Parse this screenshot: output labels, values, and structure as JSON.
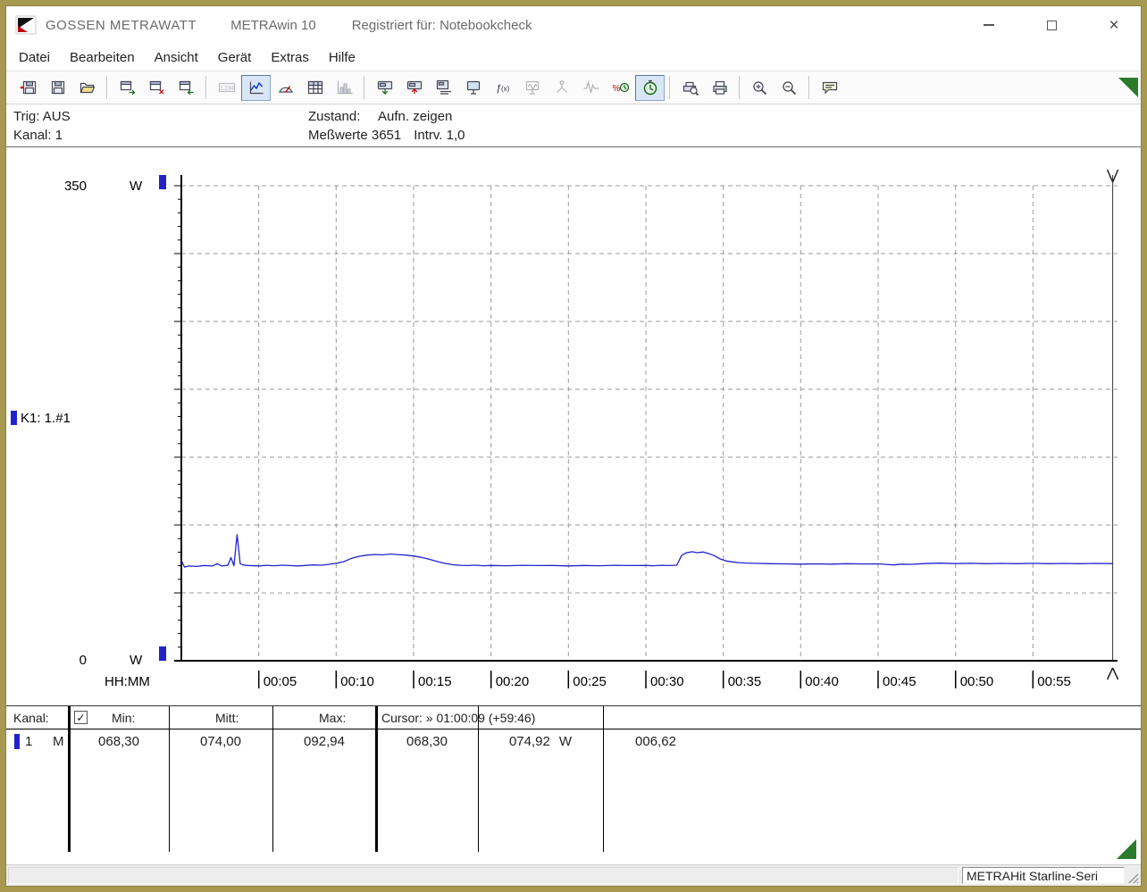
{
  "titlebar": {
    "brand": "GOSSEN METRAWATT",
    "app_title": "METRAwin 10",
    "registered": "Registriert für: Notebookcheck",
    "close_glyph": "×"
  },
  "menu": {
    "items": [
      {
        "name": "menu-item-datei",
        "label": "Datei"
      },
      {
        "name": "menu-item-bearbeiten",
        "label": "Bearbeiten"
      },
      {
        "name": "menu-item-ansicht",
        "label": "Ansicht"
      },
      {
        "name": "menu-item-geraet",
        "label": "Gerät"
      },
      {
        "name": "menu-item-extras",
        "label": "Extras"
      },
      {
        "name": "menu-item-hilfe",
        "label": "Hilfe"
      }
    ]
  },
  "toolbar": {
    "groups": [
      [
        {
          "name": "new-recording-button",
          "glyph": "disk-in"
        },
        {
          "name": "save-button",
          "glyph": "disk"
        },
        {
          "name": "open-button",
          "glyph": "folder"
        }
      ],
      [
        {
          "name": "export-window-button",
          "glyph": "win-out"
        },
        {
          "name": "close-window-button",
          "glyph": "win-red"
        },
        {
          "name": "import-window-button",
          "glyph": "win-in"
        }
      ],
      [
        {
          "name": "view-numeric-button",
          "glyph": "numeric",
          "disabled": true
        },
        {
          "name": "view-chart-button",
          "glyph": "chart",
          "active": true
        },
        {
          "name": "view-meter-button",
          "glyph": "meter"
        },
        {
          "name": "view-table-button",
          "glyph": "table"
        },
        {
          "name": "view-histogram-button",
          "glyph": "histogram",
          "disabled": true
        }
      ],
      [
        {
          "name": "device-read-button",
          "glyph": "dev-read"
        },
        {
          "name": "device-send-button",
          "glyph": "dev-send"
        },
        {
          "name": "device-list-button",
          "glyph": "dev-list"
        },
        {
          "name": "device-monitor-button",
          "glyph": "monitor"
        },
        {
          "name": "device-function-button",
          "glyph": "fx"
        },
        {
          "name": "device-scope-button",
          "glyph": "monitor-wave",
          "disabled": true
        },
        {
          "name": "device-branch-button",
          "glyph": "branch",
          "disabled": true
        },
        {
          "name": "device-waveform-button",
          "glyph": "wave",
          "disabled": true
        },
        {
          "name": "device-percent-timer-button",
          "glyph": "percent-clock"
        },
        {
          "name": "device-timer-button",
          "glyph": "timer",
          "active": true
        }
      ],
      [
        {
          "name": "print-preview-button",
          "glyph": "print-zoom"
        },
        {
          "name": "print-button",
          "glyph": "printer"
        }
      ],
      [
        {
          "name": "zoom-in-button",
          "glyph": "zoom-in"
        },
        {
          "name": "zoom-out-button",
          "glyph": "zoom-out"
        }
      ],
      [
        {
          "name": "annotation-button",
          "glyph": "note"
        }
      ]
    ]
  },
  "status_panel": {
    "trig": "Trig: AUS",
    "kanal": "Kanal: 1",
    "zustand_label": "Zustand:",
    "zustand_value": "Aufn. zeigen",
    "messwerte": "Meßwerte 3651",
    "intrv": "Intrv. 1,0"
  },
  "chart_data": {
    "type": "line",
    "title": "",
    "ylabel_top": "350",
    "ylabel_bottom": "0",
    "y_unit": "W",
    "ylim": [
      0,
      350
    ],
    "y_grid_step": 50,
    "xlabel": "HH:MM",
    "xlim_minutes": [
      0,
      60.15
    ],
    "x_grid_step_minutes": 5,
    "x_tick_minutes": [
      5,
      10,
      15,
      20,
      25,
      30,
      35,
      40,
      45,
      50,
      55
    ],
    "x_tick_labels": [
      "00:05",
      "00:10",
      "00:15",
      "00:20",
      "00:25",
      "00:30",
      "00:35",
      "00:40",
      "00:45",
      "00:50",
      "00:55"
    ],
    "channel_label": "K1: 1.#1",
    "series_color": "#2222cc",
    "grid": true,
    "legend_position": "left",
    "cursor_minutes": 60.15,
    "series": [
      {
        "name": "K1: 1.#1",
        "points_min_watts": [
          [
            0,
            74.0
          ],
          [
            0.2,
            69.0
          ],
          [
            0.5,
            69.8
          ],
          [
            1,
            69.5
          ],
          [
            1.5,
            70.2
          ],
          [
            2,
            69.8
          ],
          [
            2.3,
            71.5
          ],
          [
            2.6,
            69.9
          ],
          [
            3.0,
            70.3
          ],
          [
            3.2,
            76.0
          ],
          [
            3.4,
            70.0
          ],
          [
            3.6,
            92.9
          ],
          [
            3.8,
            71.5
          ],
          [
            4.0,
            70.5
          ],
          [
            4.3,
            70.2
          ],
          [
            5,
            69.9
          ],
          [
            5.5,
            70.3
          ],
          [
            6,
            70.0
          ],
          [
            6.5,
            70.4
          ],
          [
            7,
            70.1
          ],
          [
            7.5,
            69.9
          ],
          [
            8,
            70.2
          ],
          [
            8.5,
            70.6
          ],
          [
            9,
            70.4
          ],
          [
            9.5,
            71.0
          ],
          [
            10,
            71.8
          ],
          [
            10.5,
            73.0
          ],
          [
            11,
            75.5
          ],
          [
            11.5,
            77.0
          ],
          [
            12,
            77.8
          ],
          [
            12.5,
            78.3
          ],
          [
            13,
            78.0
          ],
          [
            13.5,
            78.6
          ],
          [
            14,
            78.2
          ],
          [
            14.5,
            77.8
          ],
          [
            15,
            77.2
          ],
          [
            15.5,
            76.2
          ],
          [
            16,
            74.8
          ],
          [
            16.5,
            73.2
          ],
          [
            17,
            71.8
          ],
          [
            17.5,
            70.8
          ],
          [
            18,
            70.3
          ],
          [
            18.5,
            70.1
          ],
          [
            19,
            70.4
          ],
          [
            19.5,
            70.0
          ],
          [
            20,
            70.2
          ],
          [
            21,
            70.0
          ],
          [
            22,
            70.3
          ],
          [
            23,
            70.1
          ],
          [
            24,
            70.2
          ],
          [
            25,
            69.9
          ],
          [
            26,
            70.2
          ],
          [
            27,
            70.0
          ],
          [
            28,
            70.3
          ],
          [
            29,
            70.1
          ],
          [
            30,
            70.2
          ],
          [
            30.5,
            70.0
          ],
          [
            31,
            70.3
          ],
          [
            31.5,
            70.1
          ],
          [
            32,
            70.4
          ],
          [
            32.3,
            77.5
          ],
          [
            32.6,
            79.5
          ],
          [
            33,
            80.3
          ],
          [
            33.3,
            79.6
          ],
          [
            33.7,
            80.1
          ],
          [
            34,
            79.2
          ],
          [
            34.4,
            77.5
          ],
          [
            34.8,
            75.0
          ],
          [
            35.2,
            73.5
          ],
          [
            35.6,
            72.8
          ],
          [
            36,
            72.3
          ],
          [
            36.5,
            72.0
          ],
          [
            37,
            71.8
          ],
          [
            38,
            71.5
          ],
          [
            39,
            71.4
          ],
          [
            40,
            71.2
          ],
          [
            41,
            71.4
          ],
          [
            42,
            71.2
          ],
          [
            43,
            71.5
          ],
          [
            44,
            71.3
          ],
          [
            45,
            71.4
          ],
          [
            45.5,
            71.0
          ],
          [
            46,
            70.6
          ],
          [
            46.5,
            71.2
          ],
          [
            47,
            71.0
          ],
          [
            48,
            71.6
          ],
          [
            49,
            71.9
          ],
          [
            50,
            71.6
          ],
          [
            51,
            71.8
          ],
          [
            52,
            71.5
          ],
          [
            53,
            71.7
          ],
          [
            54,
            71.5
          ],
          [
            55,
            71.8
          ],
          [
            56,
            71.5
          ],
          [
            57,
            71.7
          ],
          [
            58,
            71.5
          ],
          [
            59,
            71.7
          ],
          [
            60,
            71.6
          ],
          [
            60.15,
            71.6
          ]
        ]
      }
    ]
  },
  "table": {
    "kanal_label": "Kanal:",
    "checkbox_checked": true,
    "check_glyph": "✓",
    "min_label": "Min:",
    "mitt_label": "Mitt:",
    "max_label": "Max:",
    "cursor_label": "Cursor: » 01:00:09 (+59:46)",
    "row": {
      "channel": "1",
      "mode": "M",
      "min": "068,30",
      "mitt": "074,00",
      "max": "092,94",
      "cursor_a": "068,30",
      "cursor_b": "074,92",
      "unit": "W",
      "delta": "006,62"
    }
  },
  "statusbar": {
    "device": "METRAHit Starline-Seri"
  },
  "colors": {
    "accent_blue": "#2222cc",
    "window_frame": "#a89950",
    "grid_gray": "#9b9b9b",
    "triangle_green": "#2c7a2c"
  }
}
